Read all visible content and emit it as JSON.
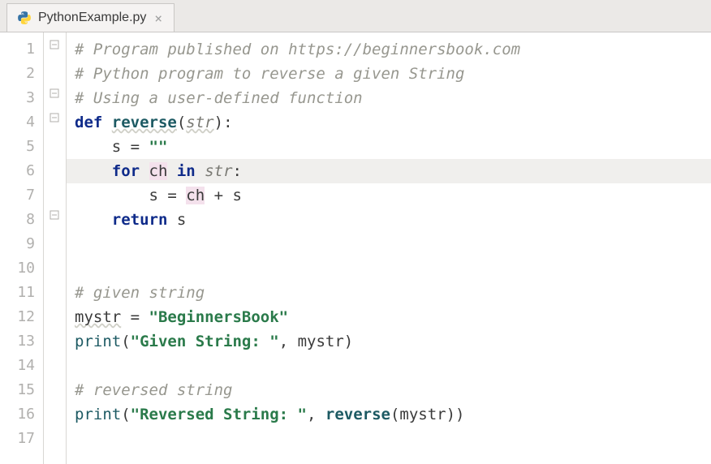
{
  "tab": {
    "filename": "PythonExample.py",
    "close_glyph": "×"
  },
  "editor": {
    "highlight_line": 6,
    "line_numbers": [
      "1",
      "2",
      "3",
      "4",
      "5",
      "6",
      "7",
      "8",
      "9",
      "10",
      "11",
      "12",
      "13",
      "14",
      "15",
      "16",
      "17"
    ],
    "lines": [
      {
        "indent": 0,
        "tokens": [
          {
            "t": "# Program published on https://beginnersbook.com",
            "c": "c-comment"
          }
        ]
      },
      {
        "indent": 0,
        "tokens": [
          {
            "t": "# Python program to reverse a given String",
            "c": "c-comment"
          }
        ]
      },
      {
        "indent": 0,
        "tokens": [
          {
            "t": "# Using a user-defined function",
            "c": "c-comment"
          }
        ]
      },
      {
        "indent": 0,
        "tokens": [
          {
            "t": "def ",
            "c": "c-kw"
          },
          {
            "t": "reverse",
            "c": "c-def c-underline"
          },
          {
            "t": "(",
            "c": "c-ident"
          },
          {
            "t": "str",
            "c": "c-param c-underline"
          },
          {
            "t": "):",
            "c": "c-ident"
          }
        ]
      },
      {
        "indent": 1,
        "tokens": [
          {
            "t": "s = ",
            "c": "c-ident"
          },
          {
            "t": "\"\"",
            "c": "c-str"
          }
        ]
      },
      {
        "indent": 1,
        "tokens": [
          {
            "t": "for ",
            "c": "c-kw"
          },
          {
            "t": "ch",
            "c": "c-var-hl"
          },
          {
            "t": " in ",
            "c": "c-kw"
          },
          {
            "t": "str",
            "c": "c-param"
          },
          {
            "t": ":",
            "c": "c-ident"
          }
        ]
      },
      {
        "indent": 2,
        "tokens": [
          {
            "t": "s = ",
            "c": "c-ident"
          },
          {
            "t": "ch",
            "c": "c-var-hl"
          },
          {
            "t": " + s",
            "c": "c-ident"
          }
        ]
      },
      {
        "indent": 1,
        "tokens": [
          {
            "t": "return ",
            "c": "c-kw"
          },
          {
            "t": "s",
            "c": "c-ident"
          }
        ]
      },
      {
        "indent": 0,
        "tokens": []
      },
      {
        "indent": 0,
        "tokens": []
      },
      {
        "indent": 0,
        "tokens": [
          {
            "t": "# given string",
            "c": "c-comment"
          }
        ]
      },
      {
        "indent": 0,
        "tokens": [
          {
            "t": "mystr",
            "c": "c-ident c-underline"
          },
          {
            "t": " = ",
            "c": "c-ident"
          },
          {
            "t": "\"BeginnersBook\"",
            "c": "c-str"
          }
        ]
      },
      {
        "indent": 0,
        "tokens": [
          {
            "t": "print",
            "c": "c-builtin"
          },
          {
            "t": "(",
            "c": "c-ident"
          },
          {
            "t": "\"Given String: \"",
            "c": "c-str"
          },
          {
            "t": ", mystr)",
            "c": "c-ident"
          }
        ]
      },
      {
        "indent": 0,
        "tokens": []
      },
      {
        "indent": 0,
        "tokens": [
          {
            "t": "# reversed string",
            "c": "c-comment"
          }
        ]
      },
      {
        "indent": 0,
        "tokens": [
          {
            "t": "print",
            "c": "c-builtin"
          },
          {
            "t": "(",
            "c": "c-ident"
          },
          {
            "t": "\"Reversed String: \"",
            "c": "c-str"
          },
          {
            "t": ", ",
            "c": "c-ident"
          },
          {
            "t": "reverse",
            "c": "c-def"
          },
          {
            "t": "(mystr))",
            "c": "c-ident"
          }
        ]
      },
      {
        "indent": 0,
        "tokens": []
      }
    ]
  }
}
